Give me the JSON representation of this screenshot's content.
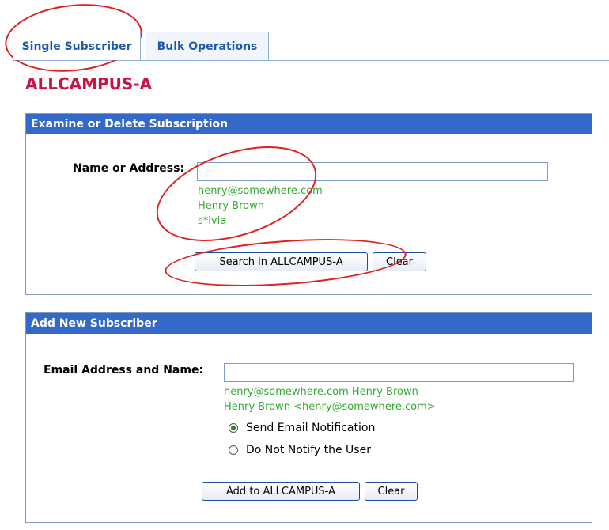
{
  "tabs": [
    {
      "label": "Single Subscriber",
      "active": true
    },
    {
      "label": "Bulk Operations",
      "active": false
    }
  ],
  "page_title": "ALLCAMPUS-A",
  "examine_panel": {
    "header": "Examine or Delete Subscription",
    "field_label": "Name or Address:",
    "input_value": "",
    "hints": [
      "henry@somewhere.com",
      "Henry Brown",
      "s*lvia"
    ],
    "search_button": "Search in ALLCAMPUS-A",
    "clear_button": "Clear"
  },
  "add_panel": {
    "header": "Add New Subscriber",
    "field_label": "Email Address and Name:",
    "input_value": "",
    "hints": [
      "henry@somewhere.com Henry Brown",
      "Henry Brown <henry@somewhere.com>"
    ],
    "radio_options": [
      {
        "label": "Send Email Notification",
        "checked": true
      },
      {
        "label": "Do Not Notify the User",
        "checked": false
      }
    ],
    "add_button": "Add to ALLCAMPUS-A",
    "clear_button": "Clear"
  },
  "colors": {
    "tab_text": "#1f5aa8",
    "title": "#cc1144",
    "panel_header_bg": "#3569c7",
    "hint_text": "#33aa33",
    "annotation": "#e02020"
  }
}
